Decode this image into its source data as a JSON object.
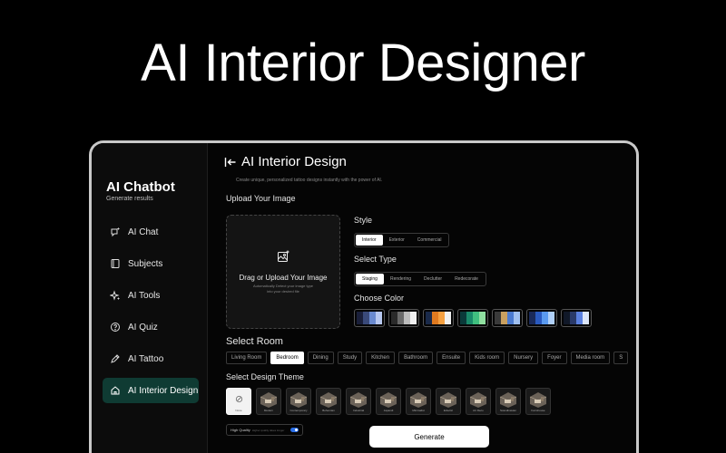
{
  "hero": {
    "title": "AI Interior Designer"
  },
  "traffic_colors": [
    "#ff5f57",
    "#febc2e",
    "#28c840"
  ],
  "brand": {
    "title": "AI Chatbot",
    "subtitle": "Generate results"
  },
  "sidebar": {
    "items": [
      {
        "label": "AI Chat",
        "icon": "chat-sparkle-icon",
        "active": false
      },
      {
        "label": "Subjects",
        "icon": "book-icon",
        "active": false
      },
      {
        "label": "AI Tools",
        "icon": "sparkles-icon",
        "active": false
      },
      {
        "label": "AI Quiz",
        "icon": "question-icon",
        "active": false
      },
      {
        "label": "AI Tattoo",
        "icon": "pen-icon",
        "active": false
      },
      {
        "label": "AI Interior Design",
        "icon": "home-icon",
        "active": true
      }
    ]
  },
  "main": {
    "title": "AI Interior Design",
    "subtitle": "Create unique, personalized tattoo designs instantly with the power of AI.",
    "upload_label": "Upload Your Image",
    "upload_box": {
      "title": "Drag or Upload Your Image",
      "hint": "Automatically Detect your image type into your desired file"
    },
    "style": {
      "label": "Style",
      "options": [
        "Interior",
        "Exterior",
        "Commercial"
      ],
      "selected": "Interior"
    },
    "type": {
      "label": "Select Type",
      "options": [
        "Staging",
        "Rendering",
        "Declutter",
        "Redecorate"
      ],
      "selected": "Staging"
    },
    "color": {
      "label": "Choose Color",
      "palettes": [
        [
          "#1a1f3a",
          "#3a4a7a",
          "#6a8ad0",
          "#b8c8f0"
        ],
        [
          "#2a2a2a",
          "#6a6a6a",
          "#bdbdbd",
          "#f0f0f0"
        ],
        [
          "#1a2a4a",
          "#e07a20",
          "#f5a040",
          "#f0f0f0"
        ],
        [
          "#0a3a3a",
          "#1a8a6a",
          "#40c080",
          "#90e0a0"
        ],
        [
          "#3a3a3a",
          "#c9a060",
          "#4a7ad0",
          "#a0c0f0"
        ],
        [
          "#1a2a5a",
          "#2a5ac0",
          "#5a9af0",
          "#b0d0f8"
        ],
        [
          "#101828",
          "#2a3a6a",
          "#5a80e0",
          "#dce6fa"
        ]
      ]
    },
    "room": {
      "label": "Select Room",
      "options": [
        "Living Room",
        "Bedroom",
        "Dining",
        "Study",
        "Kitchen",
        "Bathroom",
        "Ensuite",
        "Kids room",
        "Nursery",
        "Foyer",
        "Media room",
        "S"
      ],
      "selected": "Bedroom"
    },
    "theme": {
      "label": "Select Design Theme",
      "items": [
        "None",
        "Modern",
        "Contemporary",
        "Bohemian",
        "Industrial",
        "Japandi",
        "Minimalist",
        "Eclectic",
        "Art Deco",
        "Scandinavian",
        "Farmhouse"
      ]
    },
    "quality": {
      "label": "High Quality",
      "hint": "Higher quality takes longer",
      "enabled": true
    },
    "generate_label": "Generate"
  }
}
